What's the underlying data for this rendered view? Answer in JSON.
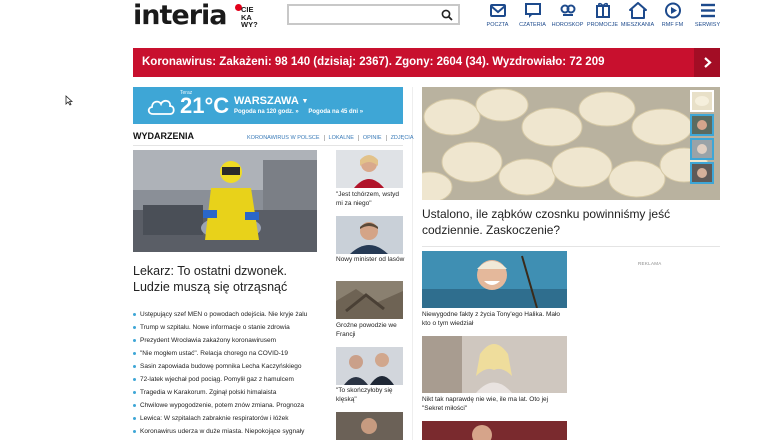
{
  "header": {
    "logo_main": "interia",
    "logo_sub_lines": [
      "CIE",
      "KA",
      "WY?"
    ],
    "search": {
      "value": "",
      "placeholder": ""
    },
    "nav": [
      {
        "label": "POCZTA",
        "icon": "mail-icon"
      },
      {
        "label": "CZATERIA",
        "icon": "chat-icon"
      },
      {
        "label": "HOROSKOP",
        "icon": "horoscope-icon"
      },
      {
        "label": "PROMOCJE",
        "icon": "promo-icon"
      },
      {
        "label": "MIESZKANIA",
        "icon": "home-icon"
      },
      {
        "label": "RMF FM",
        "icon": "play-icon"
      },
      {
        "label": "SERWISY",
        "icon": "menu-icon"
      }
    ]
  },
  "corona_bar": {
    "text": "Koronawirus: Zakażeni: 98 140 (dzisiaj: 2367). Zgony: 2604 (34). Wyzdrowiało: 72 209",
    "bg_color": "#c8102e"
  },
  "weather": {
    "today_label": "Teraz",
    "temperature": "21°C",
    "city": "WARSZAWA",
    "link_hourly": "Pogoda na 120 godz. »",
    "link_daily": "Pogoda na 45 dni »",
    "bg_color": "#3ea6d6"
  },
  "events": {
    "title": "WYDARZENIA",
    "links": [
      "KORONAWIRUS W POLSCE",
      "LOKALNE",
      "OPINIE",
      "ZDJĘCIA"
    ],
    "main_title": "Lekarz: To ostatni dzwonek. Ludzie muszą się otrząsnąć",
    "news": [
      "Ustępujący szef MEN o powodach odejścia. Nie kryje żalu",
      "Trump w szpitalu. Nowe informacje o stanie zdrowia",
      "Prezydent Wrocławia zakażony koronawirusem",
      "\"Nie mogłem ustać\". Relacja chorego na COVID-19",
      "Sasin zapowiada budowę pomnika Lecha Kaczyńskiego",
      "72-latek wjechał pod pociąg. Pomylił gaz z hamulcem",
      "Tragedia w Karakorum. Zginął polski himalaista",
      "Chwilowe wypogodzenie, potem znów zmiana. Prognoza",
      "Lewica: W szpitalach zabraknie respiratorów i łóżek",
      "Koronawirus uderza w duże miasta. Niepokojące sygnały"
    ],
    "side_captions": [
      "\"Jest tchórzem, wstyd mi za niego\"",
      "Nowy minister od lasów",
      "Groźne powodzie we Francji",
      "\"To skończyłoby się klęską\""
    ]
  },
  "right": {
    "big_title": "Ustalono, ile ząbków czosnku powinniśmy jeść codziennie. Zaskoczenie?",
    "stories": [
      "Niewygodne fakty z życia Tony'ego Halika. Mało kto o tym wiedział",
      "Nikt tak naprawdę nie wie, ile ma lat. Oto jej \"Sekret miłości\""
    ],
    "ad_label": "REKLAMA"
  },
  "colors": {
    "accent_blue": "#3ea6d6",
    "nav_blue": "#1d4a8c",
    "link_blue": "#3a7bb8"
  }
}
